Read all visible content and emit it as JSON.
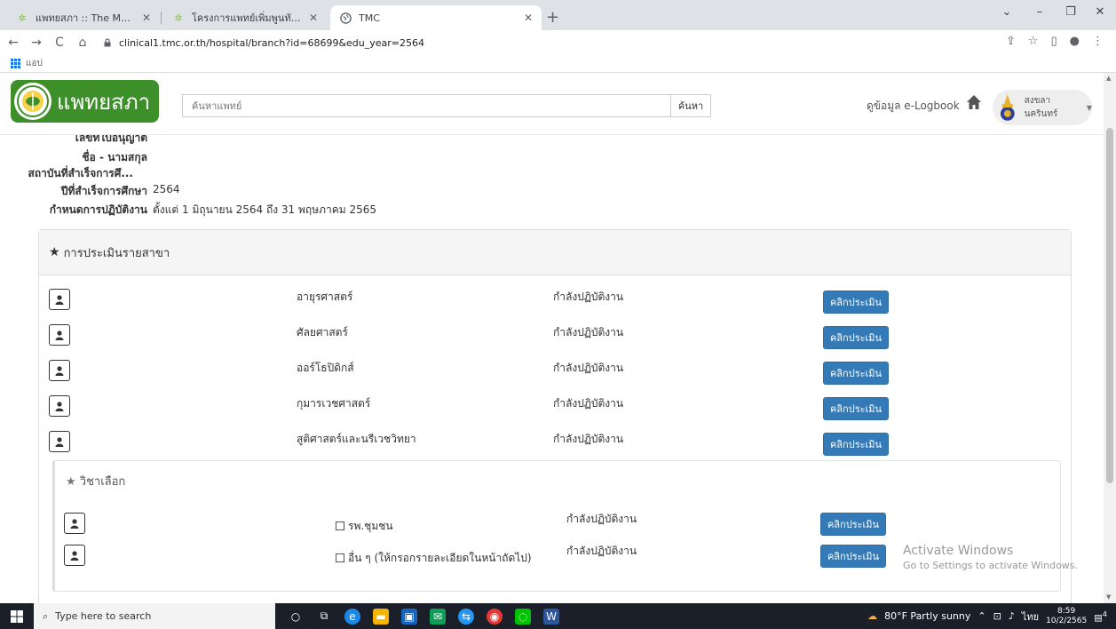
{
  "browser": {
    "tabs": [
      {
        "title": "แพทยสภา :: The Medical Council o",
        "active": false
      },
      {
        "title": "โครงการแพทย์เพิ่มพูนทักษะ - แพทยสภ",
        "active": false
      },
      {
        "title": "TMC",
        "active": true
      }
    ],
    "url": "clinical1.tmc.or.th/hospital/branch?id=68699&edu_year=2564",
    "bookmarks_label": "แอป"
  },
  "header": {
    "logo_text": "แพทยสภา",
    "search_placeholder": "ค้นหาแพทย์",
    "search_button": "ค้นหา",
    "logbook_link": "ดูข้อมูล e-Logbook",
    "user_name": "สงขลานครินทร์"
  },
  "info": {
    "license_label": "เลขที่ใบอนุญาต",
    "name_label": "ชื่อ - นามสกุล",
    "institution_label": "สถาบันที่สำเร็จการศึ...",
    "grad_year_label": "ปีที่สำเร็จการศึกษา",
    "grad_year_value": "2564",
    "schedule_label": "กำหนดการปฏิบัติงาน",
    "schedule_value": "ตั้งแต่ 1 มิถุนายน 2564  ถึง  31 พฤษภาคม 2565"
  },
  "panel": {
    "title": "การประเมินรายสาขา",
    "rows": [
      {
        "subject": "อายุรศาสตร์",
        "status": "กำลังปฏิบัติงาน",
        "button": "คลิกประเมิน"
      },
      {
        "subject": "ศัลยศาสตร์",
        "status": "กำลังปฏิบัติงาน",
        "button": "คลิกประเมิน"
      },
      {
        "subject": "ออร์โธปิดิกส์",
        "status": "กำลังปฏิบัติงาน",
        "button": "คลิกประเมิน"
      },
      {
        "subject": "กุมารเวชศาสตร์",
        "status": "กำลังปฏิบัติงาน",
        "button": "คลิกประเมิน"
      },
      {
        "subject": "สูติศาสตร์และนรีเวชวิทยา",
        "status": "กำลังปฏิบัติงาน",
        "button": "คลิกประเมิน"
      }
    ],
    "elective": {
      "title": "วิชาเลือก",
      "rows": [
        {
          "subject": "รพ.ชุมชน",
          "status": "กำลังปฏิบัติงาน",
          "button": "คลิกประเมิน"
        },
        {
          "subject": "อื่น ๆ (ให้กรอกรายละเอียดในหน้าถัดไป)",
          "status": "กำลังปฏิบัติงาน",
          "button": "คลิกประเมิน"
        }
      ]
    }
  },
  "watermark": {
    "line1": "Activate Windows",
    "line2": "Go to Settings to activate Windows."
  },
  "taskbar": {
    "search_placeholder": "Type here to search",
    "weather": "80°F  Partly sunny",
    "lang": "ไทย",
    "time": "8:59",
    "date": "10/2/2565",
    "notifications": "4"
  },
  "colors": {
    "primary_button": "#337ab7",
    "logo_green": "#3d8f2a",
    "taskbar": "#1b1f2a"
  }
}
